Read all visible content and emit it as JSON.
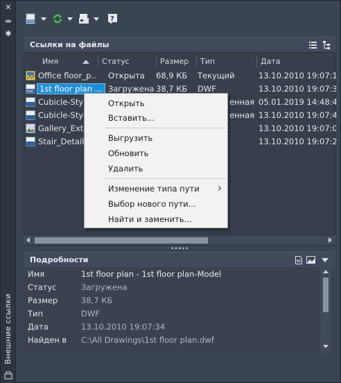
{
  "palette": "Внешние ссылки",
  "toolbar": {
    "attach_icon": "attach-dwg-icon",
    "refresh_icon": "refresh-icon",
    "change_path_icon": "change-path-icon",
    "help_icon": "help-icon"
  },
  "files": {
    "title": "Ссылки на файлы",
    "columns": [
      "Имя",
      "Статус",
      "Размер",
      "Тип",
      "Дата"
    ],
    "rows": [
      {
        "name": "Office floor_p...",
        "status": "Открыта",
        "size": "68,9 КБ",
        "type": "Текущий",
        "date": "13.10.2010 19:07:12",
        "icon": "drawing-file-icon"
      },
      {
        "name": "1st floor plan ...",
        "status": "Загружена",
        "size": "38,7 КБ",
        "type": "DWF",
        "date": "13.10.2010 19:07:34",
        "icon": "dwf-file-icon"
      },
      {
        "name": "Cubicle-Style...",
        "status": "",
        "size": "",
        "type": "енная",
        "date": "05.01.2019 14:48:40",
        "icon": "dwf-file-icon"
      },
      {
        "name": "Cubicle-Style...",
        "status": "",
        "size": "",
        "type": "енная",
        "date": "13.10.2010 19:07:40",
        "icon": "dwf-file-icon"
      },
      {
        "name": "Gallery_Exter...",
        "status": "",
        "size": "",
        "type": "",
        "date": "13.10.2010 19:07:02",
        "icon": "image-file-icon"
      },
      {
        "name": "Stair_Detail - ...",
        "status": "",
        "size": "",
        "type": "",
        "date": "13.10.2010 19:07:20",
        "icon": "dwf-file-icon"
      }
    ]
  },
  "context_menu": {
    "items": [
      "Открыть",
      "Вставить...",
      "Выгрузить",
      "Обновить",
      "Удалить",
      "Изменение типа пути",
      "Выбор нового пути...",
      "Найти и заменить..."
    ]
  },
  "details": {
    "title": "Подробности",
    "rows": [
      {
        "key": "Имя",
        "value": "1st floor plan - 1st floor plan-Model"
      },
      {
        "key": "Статус",
        "value": "Загружена"
      },
      {
        "key": "Размер",
        "value": "38,7 КБ"
      },
      {
        "key": "Тип",
        "value": "DWF"
      },
      {
        "key": "Дата",
        "value": "13.10.2010 19:07:34"
      },
      {
        "key": "Найден в",
        "value": "C:\\All Drawings\\1st floor plan.dwf"
      }
    ]
  },
  "colors": {
    "accent": "#1e8fd6",
    "panel": "#3b4453",
    "header": "#404a5b"
  }
}
